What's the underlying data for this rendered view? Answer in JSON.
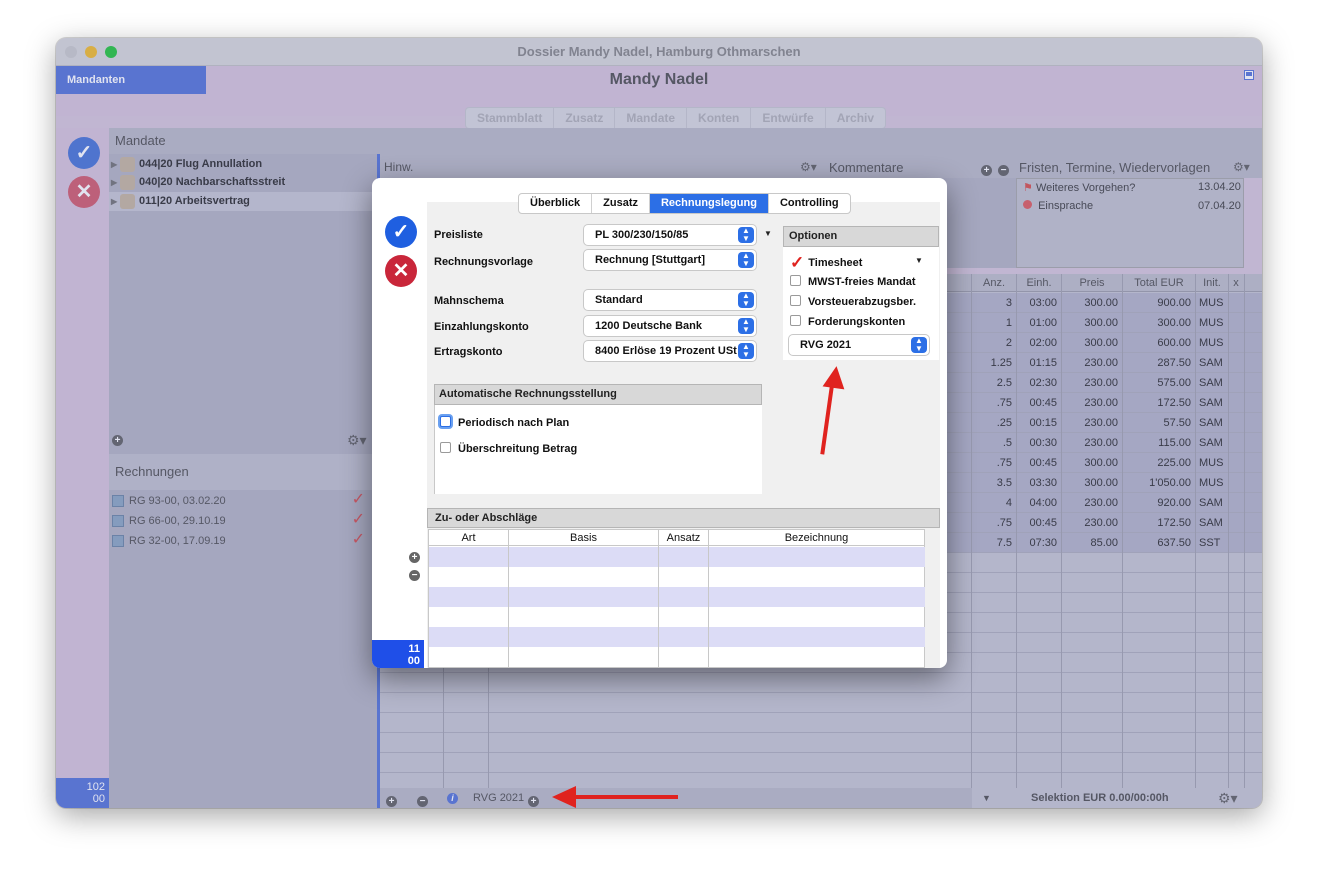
{
  "window": {
    "title": "Dossier Mandy Nadel, Hamburg Othmarschen"
  },
  "header": {
    "mandanten_tab": "Mandanten",
    "client_name": "Mandy Nadel"
  },
  "top_tabs": [
    "Stammblatt",
    "Zusatz",
    "Mandate",
    "Konten",
    "Entwürfe",
    "Archiv"
  ],
  "mandate": {
    "title": "Mandate",
    "items": [
      {
        "label": "044|20 Flug Annullation"
      },
      {
        "label": "040|20 Nachbarschaftsstreit"
      },
      {
        "label": "011|20 Arbeitsvertrag"
      }
    ]
  },
  "rechnungen": {
    "title": "Rechnungen",
    "items": [
      {
        "label": "RG 93-00, 03.02.20"
      },
      {
        "label": "RG 66-00, 29.10.19"
      },
      {
        "label": "RG 32-00, 17.09.19"
      }
    ]
  },
  "left_counter": {
    "line1": "102",
    "line2": "00"
  },
  "panels": {
    "hinw": "Hinw.",
    "kommentare": "Kommentare",
    "fristen": "Fristen, Termine, Wiedervorlagen"
  },
  "fristen": [
    {
      "label": "Weiteres Vorgehen?",
      "date": "13.04.20",
      "color": "#d9534f"
    },
    {
      "label": "Einsprache",
      "date": "07.04.20",
      "color": "#e06060"
    }
  ],
  "table": {
    "columns": [
      "Anz.",
      "Einh.",
      "Preis",
      "Total EUR",
      "Init.",
      "x"
    ],
    "rows": [
      [
        "3",
        "03:00",
        "300.00",
        "900.00",
        "MUS"
      ],
      [
        "1",
        "01:00",
        "300.00",
        "300.00",
        "MUS"
      ],
      [
        "2",
        "02:00",
        "300.00",
        "600.00",
        "MUS"
      ],
      [
        "1.25",
        "01:15",
        "230.00",
        "287.50",
        "SAM"
      ],
      [
        "2.5",
        "02:30",
        "230.00",
        "575.00",
        "SAM"
      ],
      [
        ".75",
        "00:45",
        "230.00",
        "172.50",
        "SAM"
      ],
      [
        ".25",
        "00:15",
        "230.00",
        "57.50",
        "SAM"
      ],
      [
        ".5",
        "00:30",
        "230.00",
        "115.00",
        "SAM"
      ],
      [
        ".75",
        "00:45",
        "300.00",
        "225.00",
        "MUS"
      ],
      [
        "3.5",
        "03:30",
        "300.00",
        "1'050.00",
        "MUS"
      ],
      [
        "4",
        "04:00",
        "230.00",
        "920.00",
        "SAM"
      ],
      [
        ".75",
        "00:45",
        "230.00",
        "172.50",
        "SAM"
      ],
      [
        "7.5",
        "07:30",
        "85.00",
        "637.50",
        "SST"
      ]
    ]
  },
  "bottom_bar": {
    "rvg": "RVG 2021",
    "selektion": "Selektion EUR 0.00/00:00h"
  },
  "dialog": {
    "tabs": [
      "Überblick",
      "Zusatz",
      "Rechnungslegung",
      "Controlling"
    ],
    "active_tab": "Rechnungslegung",
    "fields": {
      "preisliste": {
        "label": "Preisliste",
        "value": "PL 300/230/150/85"
      },
      "rechnungsvorlage": {
        "label": "Rechnungsvorlage",
        "value": "Rechnung [Stuttgart]"
      },
      "mahnschema": {
        "label": "Mahnschema",
        "value": "Standard"
      },
      "einzahlungskonto": {
        "label": "Einzahlungskonto",
        "value": "1200 Deutsche Bank"
      },
      "ertragskonto": {
        "label": "Ertragskonto",
        "value": "8400 Erlöse 19 Prozent USt"
      }
    },
    "optionen": {
      "title": "Optionen",
      "timesheet": "Timesheet",
      "checks": [
        "MWST-freies Mandat",
        "Vorsteuerabzugsber.",
        "Forderungskonten"
      ],
      "rvg_select": "RVG 2021"
    },
    "auto": {
      "title": "Automatische Rechnungsstellung",
      "periodisch": "Periodisch nach Plan",
      "ueberschreitung": "Überschreitung Betrag"
    },
    "zu": {
      "title": "Zu- oder Abschläge",
      "columns": [
        "Art",
        "Basis",
        "Ansatz",
        "Bezeichnung"
      ]
    },
    "counter": {
      "line1": "11",
      "line2": "00"
    }
  },
  "colors": {
    "accent": "#2c6fe6",
    "ok": "#2c6fe6",
    "cancel": "#c9263a",
    "arrow": "#e0231f"
  }
}
